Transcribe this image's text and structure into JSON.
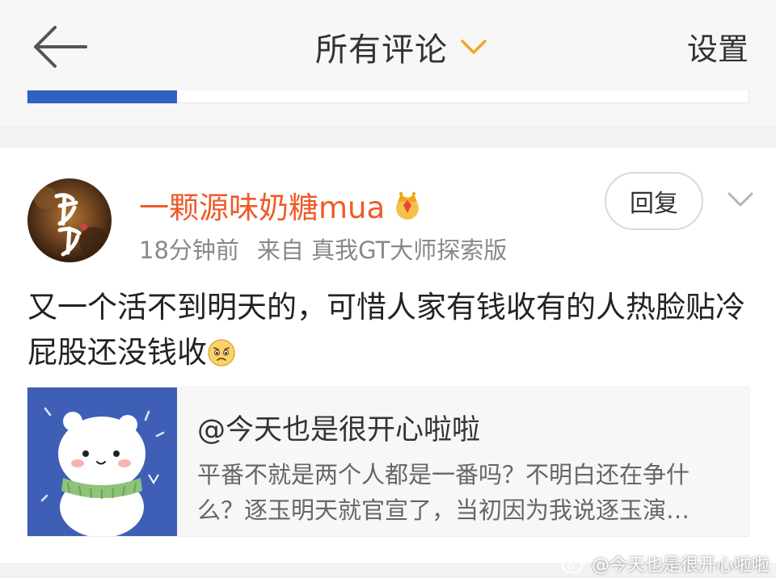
{
  "header": {
    "back_icon": "arrow-left-icon",
    "title": "所有评论",
    "title_chevron_icon": "chevron-down-icon",
    "settings_label": "设置"
  },
  "comment": {
    "username": "一颗源味奶糖mua",
    "badge_icon": "crown-icon",
    "time": "18分钟前",
    "source": "来自 真我GT大师探索版",
    "reply_label": "回复",
    "more_icon": "chevron-down-icon",
    "text": "又一个活不到明天的，可惜人家有钱收有的人热脸贴冷屁股还没钱收",
    "emoji_icon": "worried-face-icon",
    "quote": {
      "author": "@今天也是很开心啦啦",
      "line1": "平番不就是两个人都是一番吗？不明白还在争什",
      "line2": "么？逐玉明天就官宣了，当初因为我说逐玉演…"
    }
  },
  "watermark": {
    "icon": "weibo-icon",
    "text": "@今天也是很开心啦啦"
  },
  "colors": {
    "username": "#f05a28",
    "accent_chevron": "#f5a623",
    "thumb_blue": "#3f5fb7"
  }
}
